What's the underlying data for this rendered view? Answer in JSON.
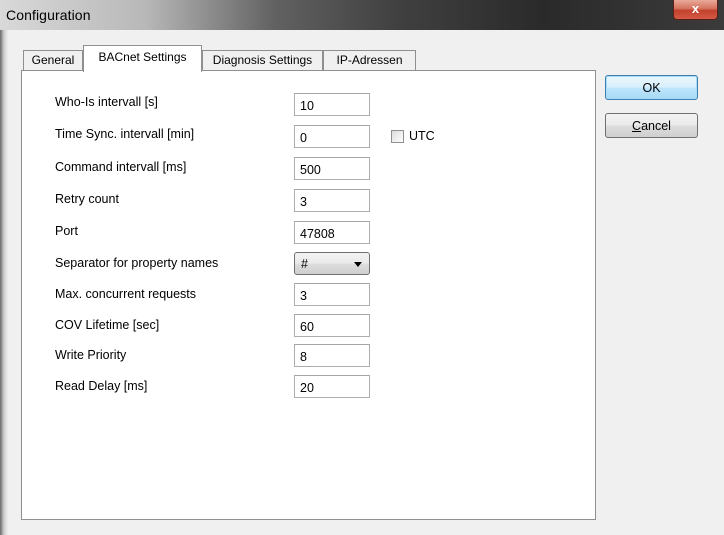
{
  "window": {
    "title": "Configuration",
    "close_glyph": "x"
  },
  "tabs": [
    {
      "label": "General",
      "active": false
    },
    {
      "label": "BACnet Settings",
      "active": true
    },
    {
      "label": "Diagnosis Settings",
      "active": false
    },
    {
      "label": "IP-Adressen",
      "active": false
    }
  ],
  "fields": [
    {
      "label": "Who-Is intervall [s]",
      "value": "10"
    },
    {
      "label": "Time Sync. intervall [min]",
      "value": "0"
    },
    {
      "label": "Command intervall [ms]",
      "value": "500"
    },
    {
      "label": "Retry count",
      "value": "3"
    },
    {
      "label": "Port",
      "value": "47808"
    },
    {
      "label": "Separator for property names",
      "value": "#"
    },
    {
      "label": "Max. concurrent requests",
      "value": "3"
    },
    {
      "label": "COV Lifetime [sec]",
      "value": "60"
    },
    {
      "label": "Write Priority",
      "value": "8"
    },
    {
      "label": "Read Delay [ms]",
      "value": "20"
    }
  ],
  "utc": {
    "label": "UTC",
    "checked": false
  },
  "buttons": {
    "ok": "OK",
    "cancel": "Cancel"
  },
  "icons": {
    "close": "close-icon",
    "dropdown": "chevron-down-icon"
  },
  "colors": {
    "title_gradient_dark": "#2a2a2a",
    "close_red": "#c2412c",
    "default_button_border": "#3c7fb1"
  }
}
